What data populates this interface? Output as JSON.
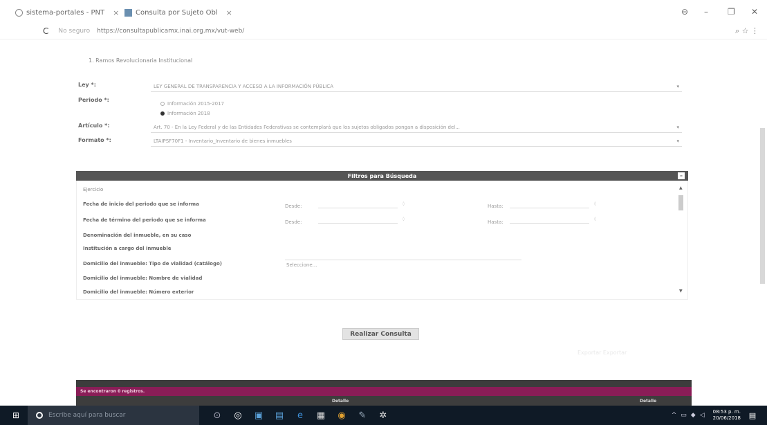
{
  "browser": {
    "tabs": [
      {
        "label": "sistema-portales - PNT",
        "close": "×"
      },
      {
        "label": "Consulta por Sujeto Obl",
        "close": "×"
      }
    ],
    "reload": "C",
    "secure_label": "No seguro",
    "url": "https://consultapublicamx.inai.org.mx/vut-web/",
    "window_controls": [
      "⊖",
      "–",
      "❐",
      "✕"
    ],
    "toolbar_icons": [
      "search-icon",
      "star-icon",
      "menu-icon"
    ]
  },
  "form": {
    "section_title": "1. Ramos Revolucionaria Institucional",
    "ley_label": "Ley *:",
    "ley_value": "LEY GENERAL DE TRANSPARENCIA Y ACCESO A LA INFORMACIÓN PÚBLICA",
    "periodo_label": "Periodo *:",
    "periodo_options": [
      {
        "label": "Información 2015-2017",
        "selected": false
      },
      {
        "label": "Información 2018",
        "selected": true
      }
    ],
    "articulo_label": "Artículo *:",
    "articulo_value": "Art. 70 - En la Ley Federal y de las Entidades Federativas se contemplará que los sujetos obligados pongan a disposición del...",
    "formato_label": "Formato *:",
    "formato_value": "LTAIPSF70F1 - Inventario_Inventario de bienes inmuebles"
  },
  "filters": {
    "title": "Filtros para Búsqueda",
    "toggle": "–",
    "rows": [
      {
        "label": "Ejercicio"
      },
      {
        "label": "Fecha de inicio del periodo que se informa",
        "from": "Desde:",
        "to": "Hasta:"
      },
      {
        "label": "Fecha de término del periodo que se informa",
        "from": "Desde:",
        "to": "Hasta:"
      },
      {
        "label": "Denominación del inmueble, en su caso"
      },
      {
        "label": "Institución a cargo del inmueble"
      },
      {
        "label": "Domicilio del inmueble: Tipo de vialidad (catálogo)",
        "select": "Seleccione..."
      },
      {
        "label": "Domicilio del inmueble: Nombre de vialidad"
      },
      {
        "label": "Domicilio del inmueble: Número exterior"
      }
    ]
  },
  "actions": {
    "consulta_label": "Realizar Consulta",
    "export_label": "Exportar   Exportar"
  },
  "results": {
    "message": "Se encontraron 0 registros.",
    "col_detalle": "Detalle",
    "col_detalle2": "Detalle"
  },
  "taskbar": {
    "search_placeholder": "Escribe aquí para buscar",
    "apps": [
      "task-view-icon",
      "files-icon",
      "store-icon",
      "terminal-icon",
      "edge-icon",
      "briefcase-icon",
      "chrome-icon",
      "paint-icon",
      "settings-icon"
    ],
    "time": "08:53 p. m.",
    "date": "20/06/2018"
  }
}
